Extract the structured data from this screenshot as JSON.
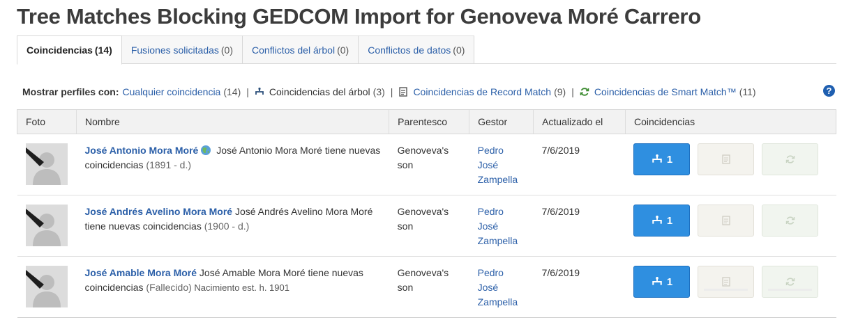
{
  "page": {
    "title": "Tree Matches Blocking GEDCOM Import for Genoveva Moré Carrero"
  },
  "tabs": [
    {
      "label": "Coincidencias",
      "count": "(14)"
    },
    {
      "label": "Fusiones solicitadas",
      "count": "(0)"
    },
    {
      "label": "Conflictos del árbol",
      "count": "(0)"
    },
    {
      "label": "Conflictos de datos",
      "count": "(0)"
    }
  ],
  "filter": {
    "lead": "Mostrar perfiles con:",
    "any_label": "Cualquier coincidencia",
    "any_count": "(14)",
    "tree_label": "Coincidencias del árbol",
    "tree_count": "(3)",
    "record_label": "Coincidencias de Record Match",
    "record_count": "(9)",
    "smart_label": "Coincidencias de Smart Match™",
    "smart_count": "(11)",
    "sep": "|"
  },
  "help": {
    "label": "?"
  },
  "table": {
    "headers": [
      "Foto",
      "Nombre",
      "Parentesco",
      "Gestor",
      "Actualizado el",
      "Coincidencias"
    ],
    "rows": [
      {
        "name": "José Antonio Mora Moré",
        "desc": " José Antonio Mora Moré tiene nuevas coincidencias ",
        "life": "(1891 - d.)",
        "extra": "",
        "relation": "Genoveva's son",
        "manager": "Pedro José Zampella",
        "updated": "7/6/2019",
        "tree_count": "1"
      },
      {
        "name": "José Andrés Avelino Mora Moré",
        "desc": " José Andrés Avelino Mora Moré tiene nuevas coincidencias ",
        "life": "(1900 - d.)",
        "extra": "",
        "relation": "Genoveva's son",
        "manager": "Pedro José Zampella",
        "updated": "7/6/2019",
        "tree_count": "1"
      },
      {
        "name": "José Amable Mora Moré",
        "desc": " José Amable Mora Moré tiene nuevas coincidencias ",
        "life": "(Fallecido)",
        "extra": " Nacimiento est. h. 1901",
        "relation": "Genoveva's son",
        "manager": "Pedro José Zampella",
        "updated": "7/6/2019",
        "tree_count": "1"
      }
    ]
  },
  "colors": {
    "accent": "#2f8fe0",
    "link": "#2b5fa8",
    "help": "#1f5fb0"
  }
}
